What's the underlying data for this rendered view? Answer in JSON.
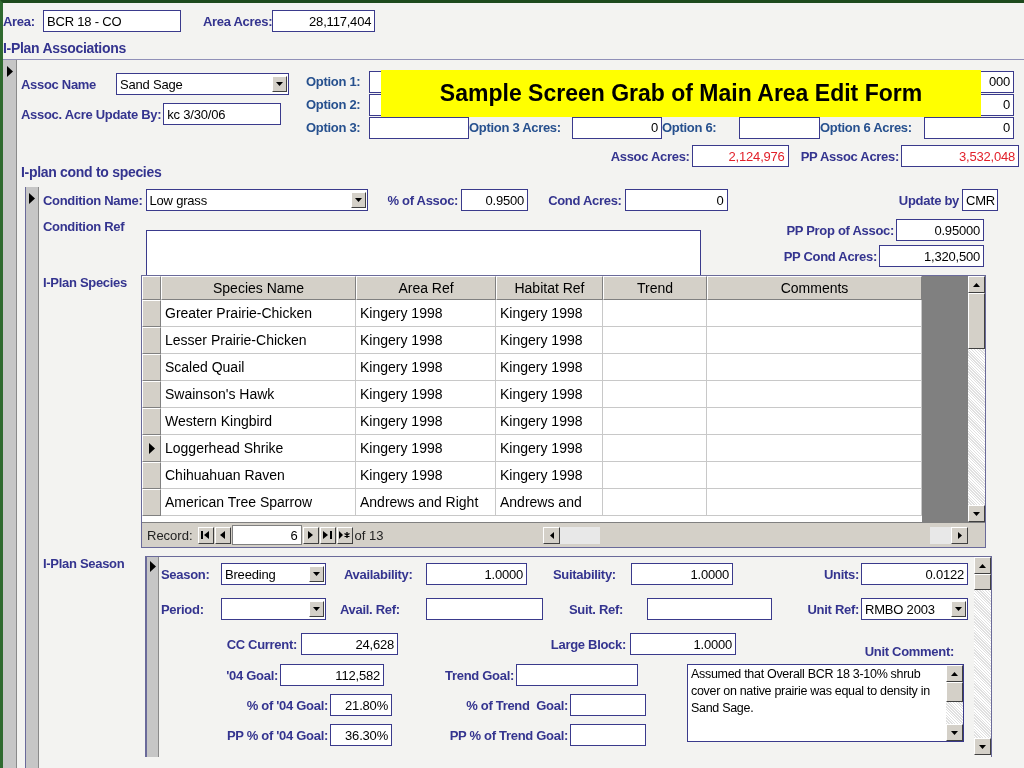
{
  "area": {
    "label": "Area:",
    "value": "BCR 18 - CO"
  },
  "area_acres": {
    "label": "Area Acres:",
    "value": "28,117,404"
  },
  "associations": {
    "title": "I-Plan Associations",
    "current": true,
    "assoc_name": {
      "label": "Assoc Name",
      "value": "Sand Sage"
    },
    "update_by": {
      "label": "Assoc. Acre Update By:",
      "value": "kc 3/30/06"
    },
    "options": [
      {
        "kind": "text",
        "label": "Option 1:"
      },
      {
        "kind": "gap"
      },
      {
        "kind": "gap"
      },
      {
        "kind": "text",
        "value": "000"
      },
      {
        "kind": "text",
        "label": "Option 2:"
      },
      {
        "kind": "gap"
      },
      {
        "kind": "gap"
      },
      {
        "kind": "text",
        "value": "0"
      },
      {
        "kind": "text",
        "label": "Option 3:"
      },
      {
        "kind": "text",
        "label": "Option 3 Acres:",
        "value": "0"
      },
      {
        "kind": "text",
        "label": "Option 6:"
      },
      {
        "kind": "text",
        "label": "Option 6 Acres:",
        "value": "0"
      }
    ],
    "assoc_acres": {
      "label": "Assoc Acres:",
      "value": "2,124,976"
    },
    "pp_assoc_acres": {
      "label": "PP Assoc Acres:",
      "value": "3,532,048"
    }
  },
  "conditions": {
    "title": "I-plan cond to species",
    "current": true,
    "condition_name": {
      "label": "Condition Name:",
      "value": "Low grass"
    },
    "pct_of_assoc": {
      "label": "% of Assoc:",
      "value": "0.9500"
    },
    "cond_acres": {
      "label": "Cond Acres:",
      "value": "0"
    },
    "update_by": {
      "label": "Update by",
      "value": "CMR"
    },
    "condition_ref": {
      "label": "Condition Ref"
    },
    "pp_prop_of_assoc": {
      "label": "PP Prop of Assoc:",
      "value": "0.95000"
    },
    "pp_cond_acres": {
      "label": "PP Cond Acres:",
      "value": "1,320,500"
    }
  },
  "species": {
    "label": "I-Plan Species",
    "columns": [
      "Species Name",
      "Area Ref",
      "Habitat Ref",
      "Trend",
      "Comments"
    ],
    "rows": [
      {
        "selected": false,
        "cells": [
          "Greater Prairie-Chicken",
          "Kingery 1998",
          "Kingery 1998"
        ]
      },
      {
        "selected": false,
        "cells": [
          "Lesser Prairie-Chicken",
          "Kingery 1998",
          "Kingery 1998"
        ]
      },
      {
        "selected": false,
        "cells": [
          "Scaled Quail",
          "Kingery 1998",
          "Kingery 1998"
        ]
      },
      {
        "selected": false,
        "cells": [
          "Swainson's Hawk",
          "Kingery 1998",
          "Kingery 1998"
        ]
      },
      {
        "selected": false,
        "cells": [
          "Western Kingbird",
          "Kingery 1998",
          "Kingery 1998"
        ]
      },
      {
        "selected": true,
        "cells": [
          "Loggerhead Shrike",
          "Kingery 1998",
          "Kingery 1998"
        ]
      },
      {
        "selected": false,
        "cells": [
          "Chihuahuan Raven",
          "Kingery 1998",
          "Kingery 1998"
        ]
      },
      {
        "selected": false,
        "cells": [
          "American Tree Sparrow",
          "Andrews and Right",
          "Andrews and"
        ]
      }
    ],
    "record_label": "Record:",
    "record_value": "6",
    "record_total": "of 13"
  },
  "season": {
    "label": "I-Plan Season",
    "current": true,
    "season": {
      "label": "Season:",
      "value": "Breeding"
    },
    "availability": {
      "label": "Availability:",
      "value": "1.0000"
    },
    "suitability": {
      "label": "Suitability:",
      "value": "1.0000"
    },
    "units": {
      "label": "Units:",
      "value": "0.0122"
    },
    "period": {
      "label": "Period:"
    },
    "avail_ref": {
      "label": "Avail. Ref:"
    },
    "suit_ref": {
      "label": "Suit. Ref:"
    },
    "unit_ref": {
      "label": "Unit Ref:",
      "value": "RMBO 2003"
    },
    "cc_current": {
      "label": "CC Current:",
      "value": "24,628"
    },
    "large_block": {
      "label": "Large Block:",
      "value": "1.0000"
    },
    "unit_comment": {
      "label": "Unit Comment:",
      "value": "Assumed that Overall BCR 18 3-10% shrub cover on native prairie was equal to density in Sand Sage."
    },
    "goal_04": {
      "label": "'04 Goal:",
      "value": "112,582"
    },
    "trend_goal": {
      "label": "Trend Goal:"
    },
    "pct_goal_04": {
      "label": "% of '04 Goal:",
      "value": "21.80%"
    },
    "pct_trend_goal": {
      "label": "% of Trend  Goal:"
    },
    "pp_pct_goal_04": {
      "label": "PP % of '04 Goal:",
      "value": "36.30%"
    },
    "pp_pct_trend_goal": {
      "label": "PP % of Trend Goal:"
    }
  },
  "callout": {
    "text": "Sample Screen Grab of Main Area Edit Form"
  }
}
